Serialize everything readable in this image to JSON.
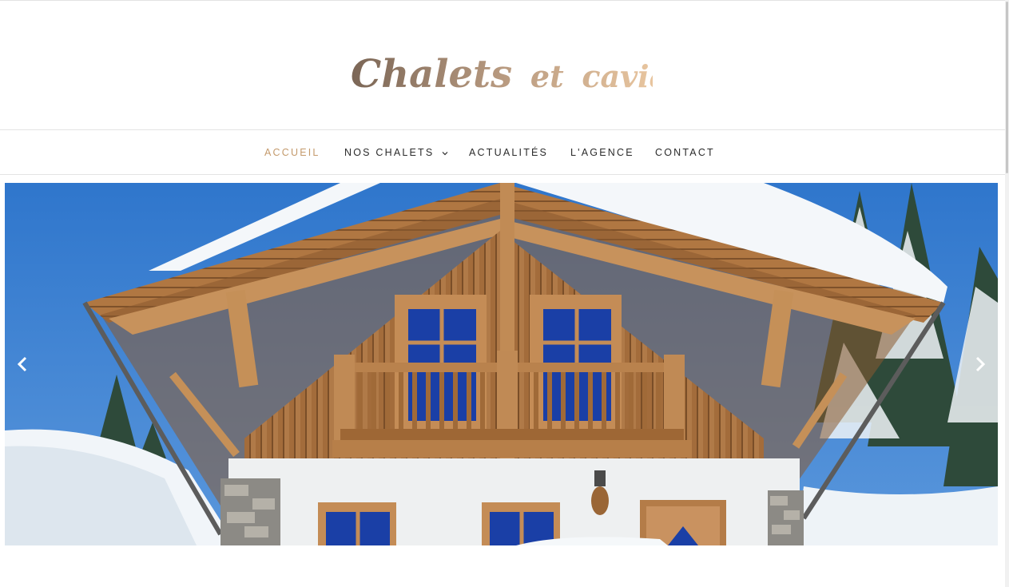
{
  "brand": {
    "name_part1": "Chalets",
    "name_part2": "et",
    "name_part3": "caviar"
  },
  "nav": {
    "items": [
      {
        "label": "ACCUEIL",
        "active": true
      },
      {
        "label": "NOS CHALETS",
        "has_dropdown": true
      },
      {
        "label": "ACTUALITÉS"
      },
      {
        "label": "L'AGENCE"
      },
      {
        "label": "CONTACT"
      }
    ]
  },
  "slider": {
    "prev_icon": "chevron-left-icon",
    "next_icon": "chevron-right-icon"
  },
  "colors": {
    "accent": "#c49a6c",
    "nav_text": "#2b2b2b",
    "sky": "#3b7fcf",
    "wood": "#a8703f"
  }
}
